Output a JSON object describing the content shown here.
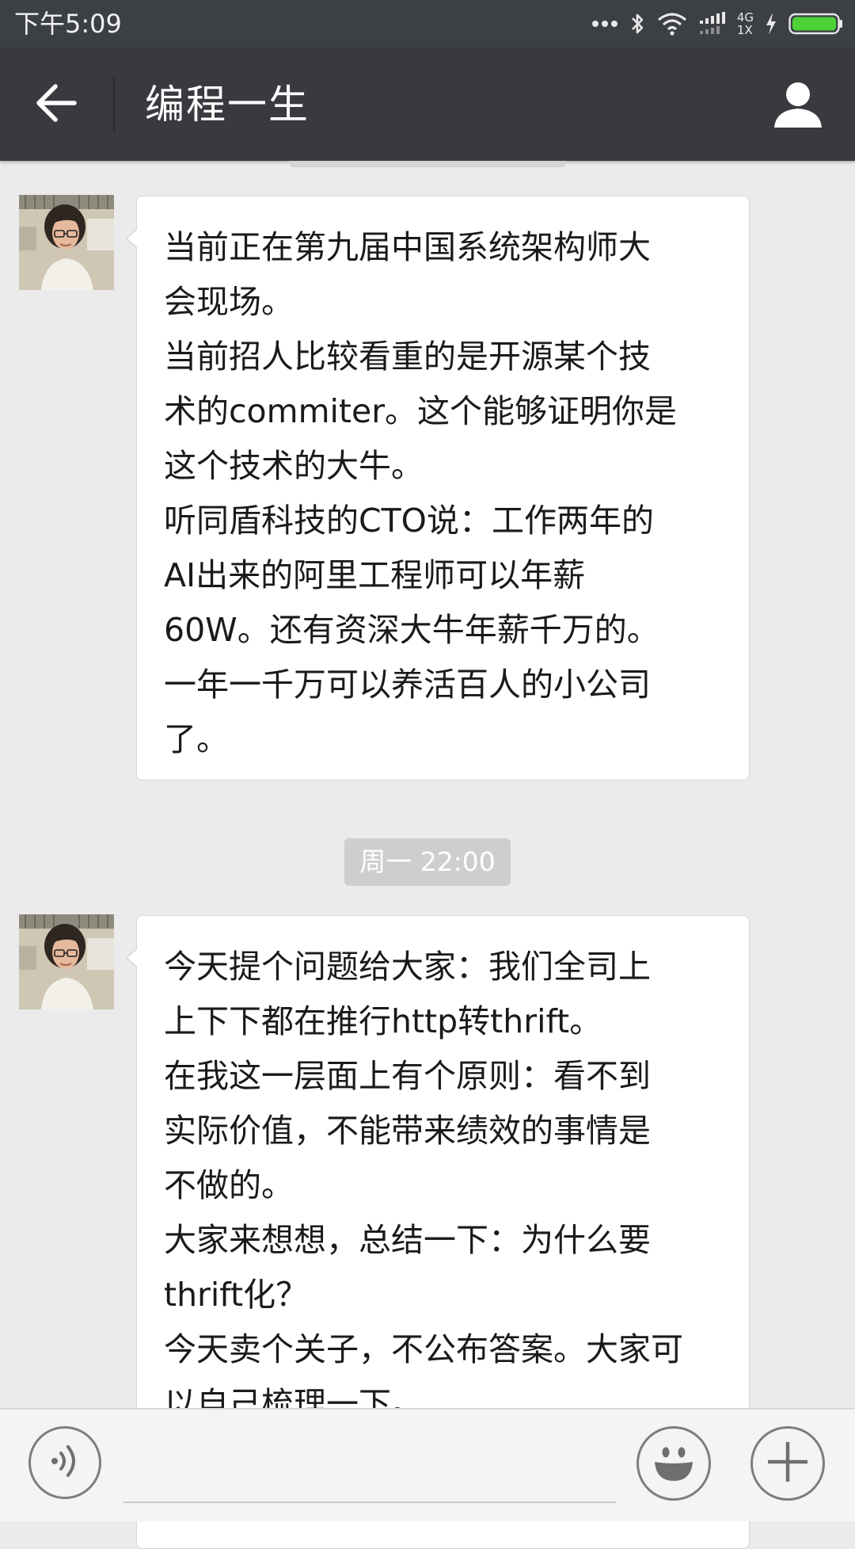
{
  "status_bar": {
    "time": "下午5:09",
    "network_top": "4G",
    "network_bottom": "1X",
    "icons": [
      "more-dots-icon",
      "bluetooth-icon",
      "wifi-icon",
      "signal-icon",
      "charging-icon",
      "battery-icon"
    ],
    "battery_level": 0.95,
    "battery_color": "#4cd137"
  },
  "title_bar": {
    "title": "编程一生",
    "back_icon": "arrow-left-icon",
    "profile_icon": "person-icon",
    "background": "#393a3f"
  },
  "messages": [
    {
      "type": "received",
      "lines": [
        "当前正在第九届中国系统架构师大",
        "会现场。",
        "当前招人比较看重的是开源某个技",
        "术的commiter。这个能够证明你是",
        "这个技术的大牛。",
        "听同盾科技的CTO说：工作两年的",
        "AI出来的阿里工程师可以年薪",
        "60W。还有资深大牛年薪千万的。",
        "一年一千万可以养活百人的小公司",
        "了。"
      ]
    },
    {
      "type": "received",
      "lines": [
        "今天提个问题给大家：我们全司上",
        "上下下都在推行http转thrift。",
        "在我这一层面上有个原则：看不到",
        "实际价值，不能带来绩效的事情是",
        "不做的。",
        "大家来想想，总结一下：为什么要",
        "thrift化？",
        "今天卖个关子，不公布答案。大家可",
        "以自己梳理一下。"
      ]
    }
  ],
  "timestamp": "周一 22:00",
  "input_bar": {
    "voice_icon": "voice-icon",
    "emoji_icon": "emoji-icon",
    "plus_icon": "plus-icon"
  }
}
